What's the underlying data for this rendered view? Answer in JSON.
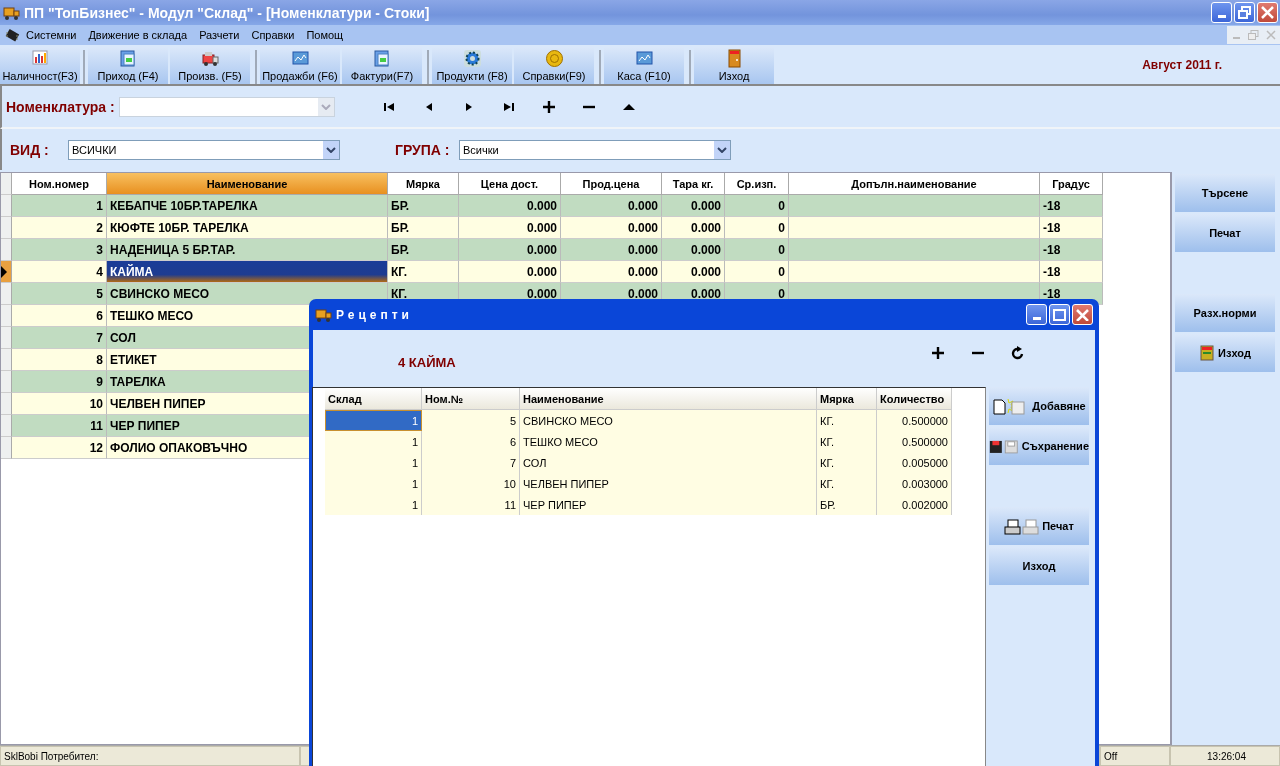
{
  "window": {
    "title": "ПП \"ТопБизнес\" - Модул \"Склад\" - [Номенклатури - Стоки]"
  },
  "menu": [
    "Системни",
    "Движение в склада",
    "Разчети",
    "Справки",
    "Помощ"
  ],
  "toolbar_groups": [
    [
      "Наличност(F3)"
    ],
    [
      "Приход (F4)",
      "Произв. (F5)"
    ],
    [
      "Продажби (F6)",
      "Фактури(F7)"
    ],
    [
      "Продукти (F8)",
      "Справки(F9)"
    ],
    [
      "Каса (F10)"
    ],
    [
      "Изход"
    ]
  ],
  "date": "Август 2011 г.",
  "nomenclature": {
    "label": "Номенклатура :",
    "disabled": true
  },
  "filters": [
    {
      "label": "ВИД :",
      "value": "ВСИЧКИ"
    },
    {
      "label": "ГРУПА :",
      "value": "Всички"
    }
  ],
  "table": {
    "columns": [
      {
        "label": "Ном.номер",
        "active": false
      },
      {
        "label": "Наименование",
        "active": true
      },
      {
        "label": "Мярка",
        "active": false
      },
      {
        "label": "Цена дост.",
        "active": false
      },
      {
        "label": "Прод.цена",
        "active": false
      },
      {
        "label": "Тара кг.",
        "active": false
      },
      {
        "label": "Ср.изп.",
        "active": false
      },
      {
        "label": "Допълн.наименование",
        "active": false
      },
      {
        "label": "Градус",
        "active": false
      }
    ],
    "rows": [
      {
        "selected": false,
        "cells": [
          "1",
          "КЕБАПЧЕ 10БР.ТАРЕЛКА",
          "БР.",
          "0.000",
          "0.000",
          "0.000",
          "0",
          "",
          "-18"
        ]
      },
      {
        "selected": false,
        "cells": [
          "2",
          "КЮФТЕ 10БР. ТАРЕЛКА",
          "БР.",
          "0.000",
          "0.000",
          "0.000",
          "0",
          "",
          "-18"
        ]
      },
      {
        "selected": false,
        "cells": [
          "3",
          "НАДЕНИЦА 5 БР.ТАР.",
          "БР.",
          "0.000",
          "0.000",
          "0.000",
          "0",
          "",
          "-18"
        ]
      },
      {
        "selected": true,
        "cells": [
          "4",
          "КАЙМА",
          "КГ.",
          "0.000",
          "0.000",
          "0.000",
          "0",
          "",
          "-18"
        ]
      },
      {
        "selected": false,
        "cells": [
          "5",
          "СВИНСКО МЕСО",
          "КГ.",
          "0.000",
          "0.000",
          "0.000",
          "0",
          "",
          "-18"
        ]
      },
      {
        "selected": false,
        "cells": [
          "6",
          "ТЕШКО МЕСО"
        ]
      },
      {
        "selected": false,
        "cells": [
          "7",
          "СОЛ"
        ]
      },
      {
        "selected": false,
        "cells": [
          "8",
          "ЕТИКЕТ"
        ]
      },
      {
        "selected": false,
        "cells": [
          "9",
          "ТАРЕЛКА"
        ]
      },
      {
        "selected": false,
        "cells": [
          "10",
          "ЧЕЛВЕН ПИПЕР"
        ]
      },
      {
        "selected": false,
        "cells": [
          "11",
          "ЧЕР ПИПЕР"
        ]
      },
      {
        "selected": false,
        "cells": [
          "12",
          "ФОЛИО ОПАКОВЪЧНО"
        ]
      }
    ]
  },
  "side_buttons": [
    "Търсене",
    "Печат",
    "Разх.норми",
    "Изход"
  ],
  "dialog": {
    "title": "Рецепти",
    "heading": "4 КАЙМА",
    "columns": [
      "Склад",
      "Ном.№",
      "Наименование",
      "Мярка",
      "Количество"
    ],
    "rows": [
      {
        "selected": true,
        "cells": [
          "1",
          "5",
          "СВИНСКО МЕСО",
          "КГ.",
          "0.500000"
        ]
      },
      {
        "selected": false,
        "cells": [
          "1",
          "6",
          "ТЕШКО МЕСО",
          "КГ.",
          "0.500000"
        ]
      },
      {
        "selected": false,
        "cells": [
          "1",
          "7",
          "СОЛ",
          "КГ.",
          "0.005000"
        ]
      },
      {
        "selected": false,
        "cells": [
          "1",
          "10",
          "ЧЕЛВЕН ПИПЕР",
          "КГ.",
          "0.003000"
        ]
      },
      {
        "selected": false,
        "cells": [
          "1",
          "11",
          "ЧЕР ПИПЕР",
          "БР.",
          "0.002000"
        ]
      }
    ],
    "buttons": [
      "Добавяне",
      "Съхранение",
      "Печат",
      "Изход"
    ]
  },
  "status_bar": {
    "user": "SklBobi Потребител:",
    "mode": "Off",
    "time": "13:26:04"
  }
}
